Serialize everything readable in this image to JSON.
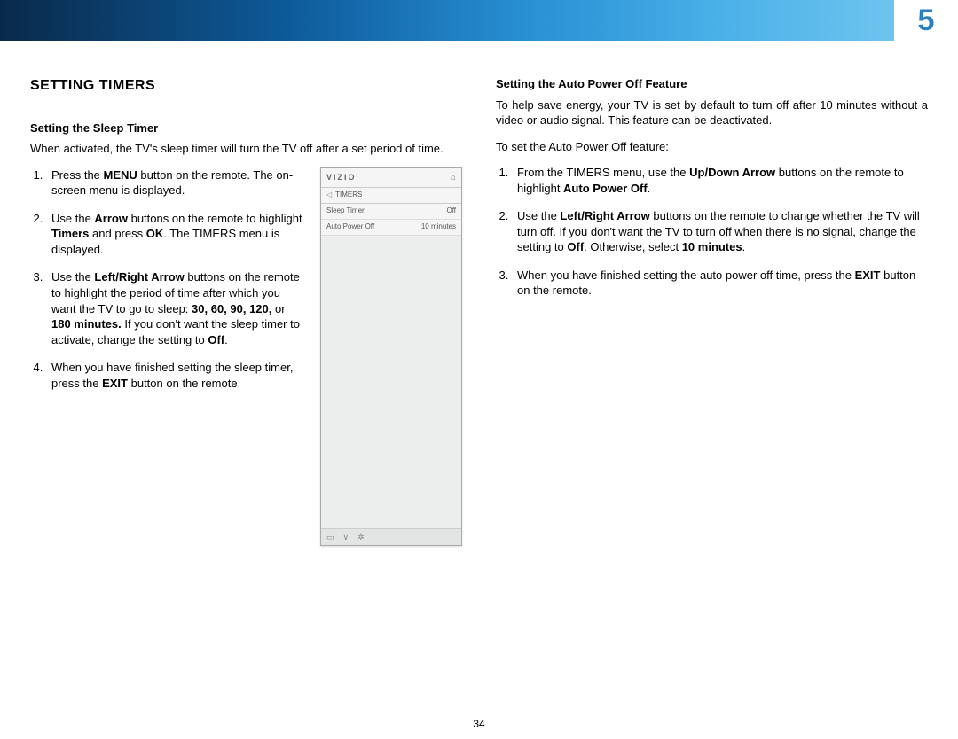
{
  "chapter": "5",
  "page_number": "34",
  "left": {
    "heading": "SETTING TIMERS",
    "sub": "Setting the Sleep Timer",
    "intro": "When activated, the TV's sleep timer will turn the TV off after a set period of time.",
    "step1_a": "Press the ",
    "step1_b": "MENU",
    "step1_c": " button on the remote. The on-screen menu is displayed.",
    "step2_a": "Use the ",
    "step2_b": "Arrow",
    "step2_c": " buttons on the remote to highlight ",
    "step2_d": "Timers",
    "step2_e": " and press ",
    "step2_f": "OK",
    "step2_g": ". The TIMERS menu is displayed.",
    "step3_a": "Use the ",
    "step3_b": "Left/Right Arrow",
    "step3_c": " buttons on the remote to highlight the period of time after which you want the TV to go to sleep: ",
    "step3_d": "30, 60, 90, 120,",
    "step3_e": " or ",
    "step3_f": "180 minutes.",
    "step3_g": " If you don't want the sleep timer to activate, change the setting to ",
    "step3_h": "Off",
    "step3_i": ".",
    "step4_a": "When you have finished setting the sleep timer, press the ",
    "step4_b": "EXIT",
    "step4_c": " button on the remote."
  },
  "osd": {
    "logo": "VIZIO",
    "crumb": "TIMERS",
    "row1_label": "Sleep Timer",
    "row1_value": "Off",
    "row2_label": "Auto Power Off",
    "row2_value": "10 minutes"
  },
  "right": {
    "sub": "Setting the Auto Power Off Feature",
    "intro": "To help save energy, your TV is set by default to turn off after 10 minutes without a video or audio signal. This feature can be deactivated.",
    "lead": "To set the Auto Power Off feature:",
    "step1_a": "From the TIMERS menu, use the ",
    "step1_b": "Up/Down Arrow",
    "step1_c": " buttons on the remote to highlight ",
    "step1_d": "Auto Power Off",
    "step1_e": ".",
    "step2_a": "Use the ",
    "step2_b": "Left/Right Arrow",
    "step2_c": " buttons on the remote to change whether the TV will turn off. If you don't want the TV to turn off when there is no signal, change the setting to ",
    "step2_d": "Off",
    "step2_e": ". Otherwise, select ",
    "step2_f": "10 minutes",
    "step2_g": ".",
    "step3_a": "When you have finished setting the auto power off time, press the ",
    "step3_b": "EXIT",
    "step3_c": " button on the remote."
  }
}
